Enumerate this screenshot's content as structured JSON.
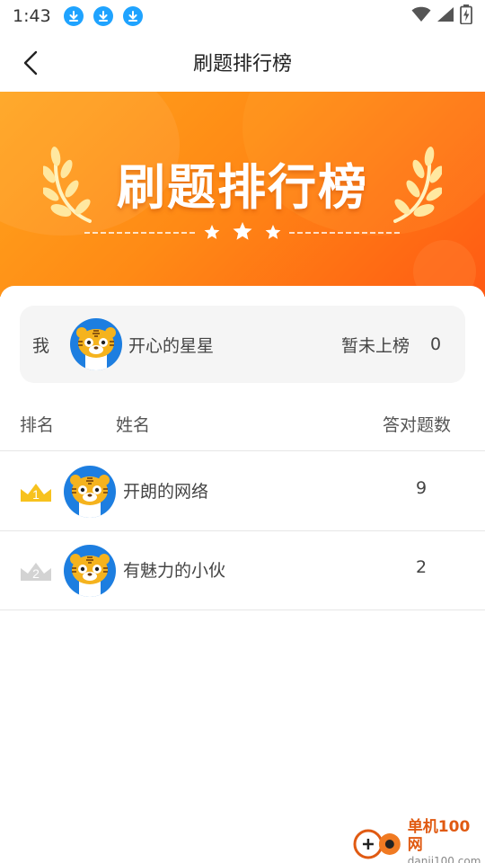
{
  "status_bar": {
    "time": "1:43",
    "download_count": 3
  },
  "nav": {
    "title": "刷题排行榜"
  },
  "banner": {
    "title": "刷题排行榜"
  },
  "my_rank": {
    "label": "我",
    "name": "开心的星星",
    "status": "暂未上榜",
    "score": "0"
  },
  "table_header": {
    "rank": "排名",
    "name": "姓名",
    "correct": "答对题数"
  },
  "rows": [
    {
      "rank": "1",
      "name": "开朗的网络",
      "score": "9",
      "crown_color": "#f7c21e"
    },
    {
      "rank": "2",
      "name": "有魅力的小伙",
      "score": "2",
      "crown_color": "#d3d3d3"
    }
  ],
  "watermark": {
    "cn": "单机100网",
    "en": "danji100.com"
  },
  "colors": {
    "banner_start": "#ffa41c",
    "banner_end": "#ff5a14",
    "avatar_bg": "#1d7ee0",
    "download_icon": "#1fa3ff"
  }
}
